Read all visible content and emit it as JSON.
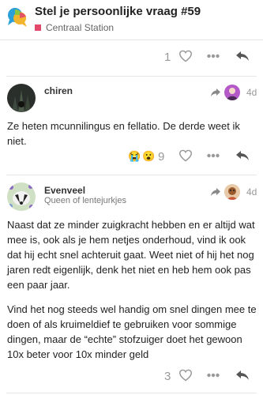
{
  "topic": {
    "title": "Stel je persoonlijke vraag #59",
    "category": "Centraal Station",
    "category_color": "#e2476c"
  },
  "posts": [
    {
      "id": "prev",
      "likes": "1"
    },
    {
      "id": "chiren",
      "username": "chiren",
      "user_title": "",
      "date": "4d",
      "body": [
        "Ze heten mcunnilingus en fellatio. De derde weet ik niet."
      ],
      "reactions": [
        "😭",
        "😮"
      ],
      "reaction_count": "9"
    },
    {
      "id": "evenveel",
      "username": "Evenveel",
      "user_title": "Queen of lentejurkjes",
      "date": "4d",
      "body": [
        "Naast dat ze minder zuigkracht hebben en er altijd wat mee is, ook als je hem netjes onderhoud, vind ik ook dat hij echt snel achteruit gaat. Weet niet of hij het nog jaren redt eigenlijk, denk het niet en heb hem ook pas een paar jaar.",
        "Vind het nog steeds wel handig om snel dingen mee te doen of als kruimeldief te gebruiken voor sommige dingen, maar de “echte” stofzuiger doet het gewoon 10x beter voor 10x minder geld"
      ],
      "likes": "3"
    }
  ],
  "icons": [
    "chat-bubbles-logo",
    "heart-icon",
    "more-icon",
    "reply-icon",
    "reply-to-arrow-icon"
  ]
}
